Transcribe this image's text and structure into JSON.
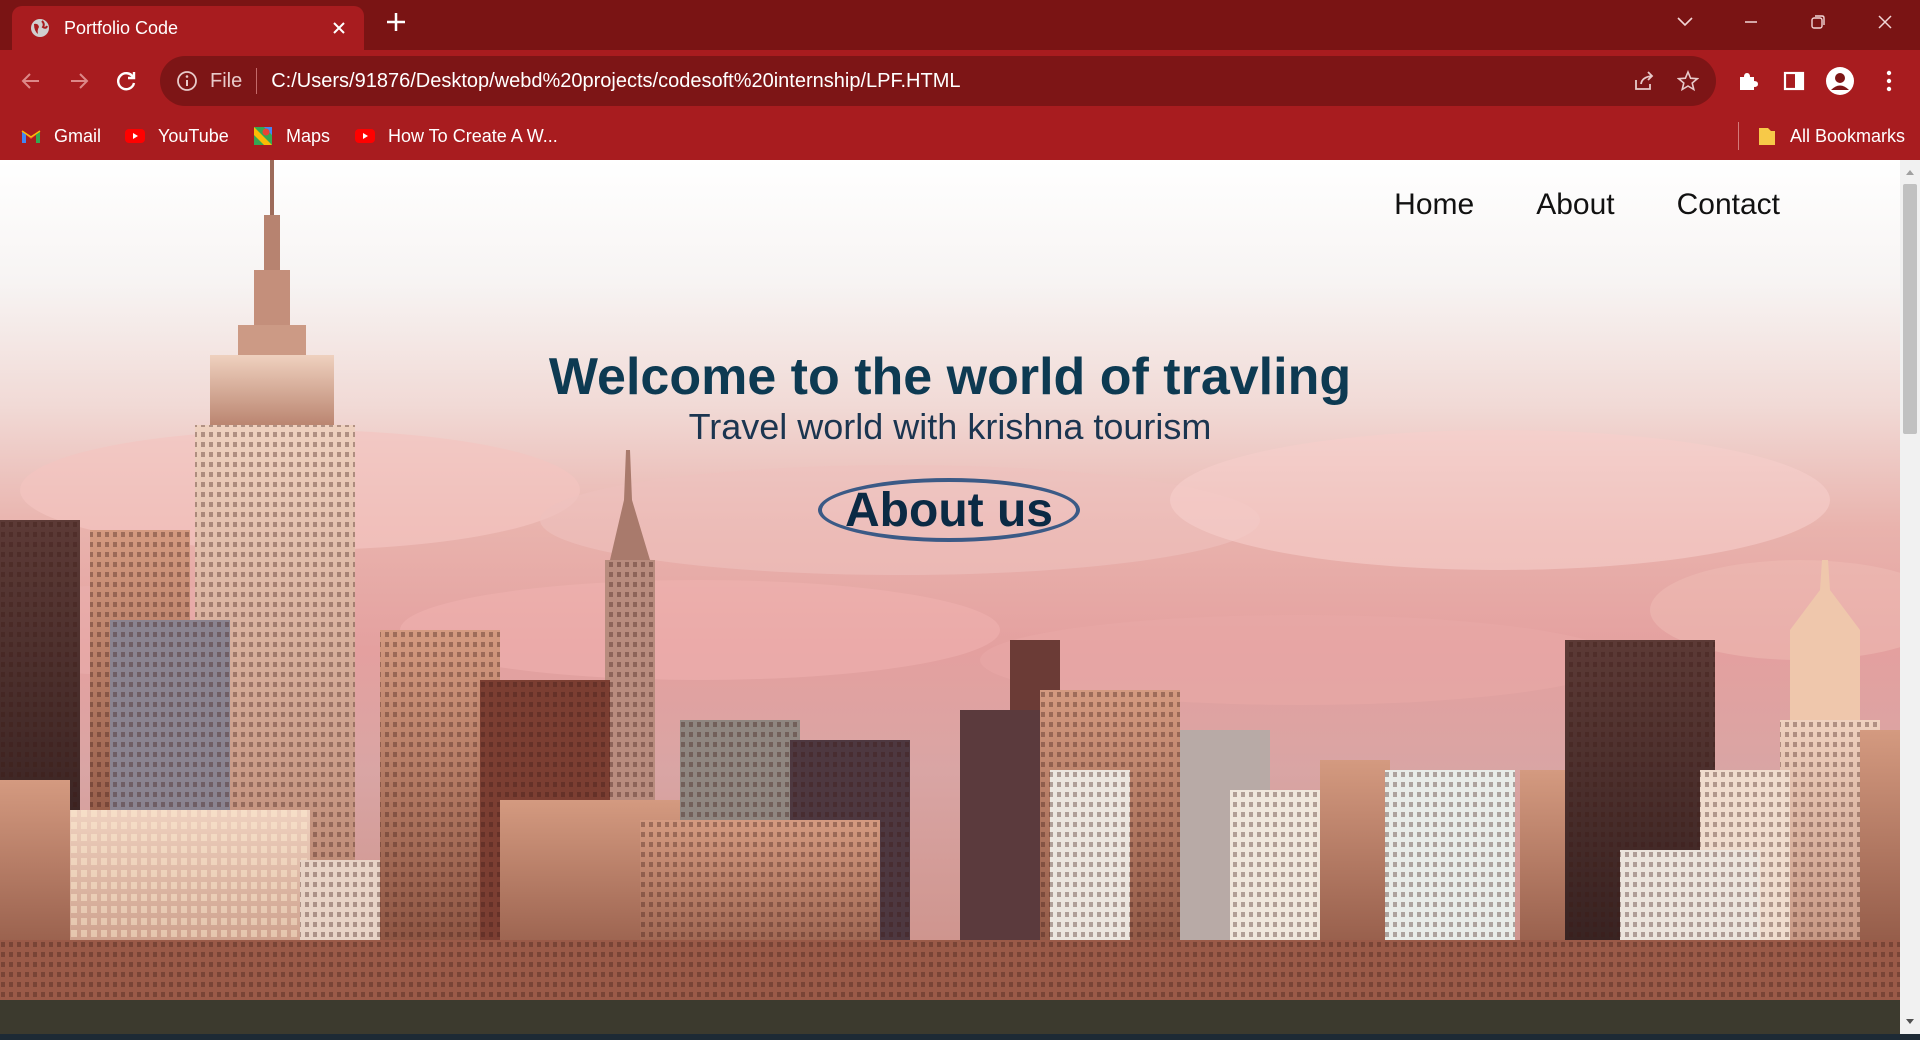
{
  "browser": {
    "tab": {
      "title": "Portfolio Code"
    },
    "address": {
      "scheme_label": "File",
      "url": "C:/Users/91876/Desktop/webd%20projects/codesoft%20internship/LPF.HTML"
    },
    "bookmarks": [
      {
        "label": "Gmail",
        "icon": "gmail-icon"
      },
      {
        "label": "YouTube",
        "icon": "youtube-icon"
      },
      {
        "label": "Maps",
        "icon": "maps-icon"
      },
      {
        "label": "How To Create A W...",
        "icon": "youtube-icon"
      }
    ],
    "all_bookmarks": "All Bookmarks",
    "colors": {
      "frame": "#7a1414",
      "toolbar": "#a81c1f",
      "omnibox": "#7d1516"
    }
  },
  "page": {
    "nav": [
      "Home",
      "About",
      "Contact"
    ],
    "hero": {
      "title": "Welcome to the world of travling",
      "subtitle": "Travel world with krishna tourism",
      "button": "About us"
    },
    "colors": {
      "title": "#0d3a52",
      "button_border": "#3b5a86"
    }
  }
}
